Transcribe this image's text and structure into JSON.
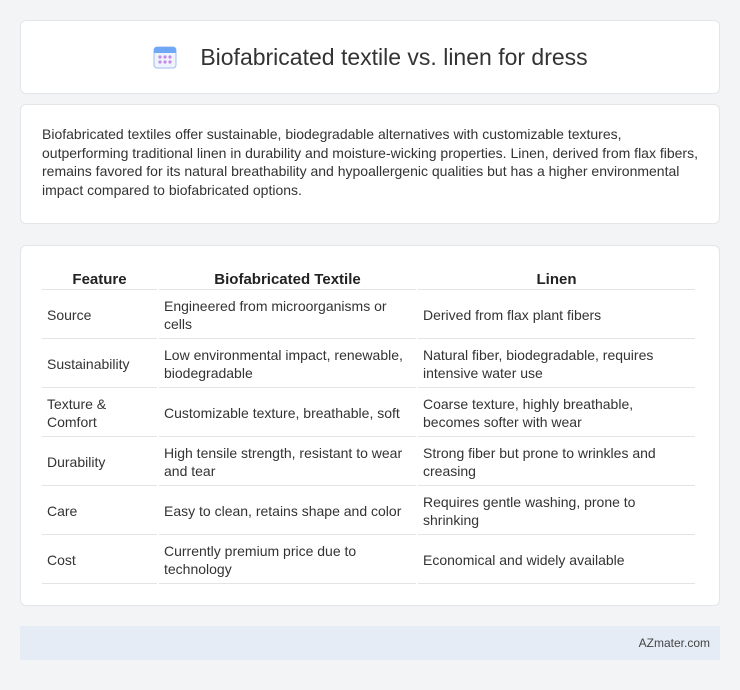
{
  "header": {
    "title": "Biofabricated textile vs. linen for dress",
    "icon": "calendar-icon",
    "icon_colors": {
      "top": "#6fa8f5",
      "body": "#eef3fc",
      "dots": "#c58be8"
    }
  },
  "intro": {
    "text": "Biofabricated textiles offer sustainable, biodegradable alternatives with customizable textures, outperforming traditional linen in durability and moisture-wicking properties. Linen, derived from flax fibers, remains favored for its natural breathability and hypoallergenic qualities but has a higher environmental impact compared to biofabricated options."
  },
  "table": {
    "headers": [
      "Feature",
      "Biofabricated Textile",
      "Linen"
    ],
    "rows": [
      [
        "Source",
        "Engineered from microorganisms or cells",
        "Derived from flax plant fibers"
      ],
      [
        "Sustainability",
        "Low environmental impact, renewable, biodegradable",
        "Natural fiber, biodegradable, requires intensive water use"
      ],
      [
        "Texture & Comfort",
        "Customizable texture, breathable, soft",
        "Coarse texture, highly breathable, becomes softer with wear"
      ],
      [
        "Durability",
        "High tensile strength, resistant to wear and tear",
        "Strong fiber but prone to wrinkles and creasing"
      ],
      [
        "Care",
        "Easy to clean, retains shape and color",
        "Requires gentle washing, prone to shrinking"
      ],
      [
        "Cost",
        "Currently premium price due to technology",
        "Economical and widely available"
      ]
    ]
  },
  "footer": {
    "brand": "AZmater.com"
  }
}
